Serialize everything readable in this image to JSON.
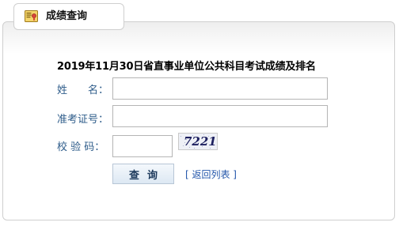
{
  "tab": {
    "title": "成绩查询",
    "icon": "certificate-icon"
  },
  "form": {
    "title": "2019年11月30日省直事业单位公共科目考试成绩及排名",
    "fields": {
      "name": {
        "label": "姓　　名：",
        "value": "",
        "placeholder": ""
      },
      "exam_id": {
        "label": "准考证号：",
        "value": "",
        "placeholder": ""
      },
      "verify_code": {
        "label": "校 验 码：",
        "value": "",
        "placeholder": ""
      }
    },
    "captcha_text": "7221",
    "query_button": "查询",
    "back_link": "[ 返回列表 ]"
  },
  "colors": {
    "label": "#2e5c8a",
    "link": "#2255aa",
    "border": "#cfcfcf"
  }
}
